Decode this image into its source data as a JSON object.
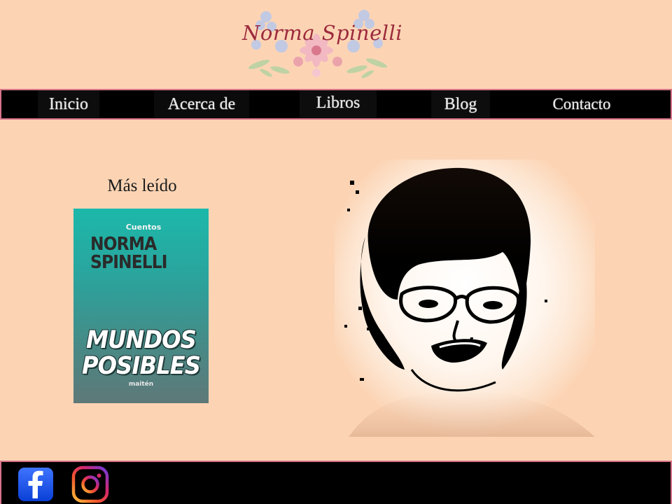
{
  "site": {
    "logo_text": "Norma Spinelli"
  },
  "nav": {
    "items": [
      {
        "label": "Inicio"
      },
      {
        "label": "Acerca de"
      },
      {
        "label": "Libros"
      },
      {
        "label": "Blog"
      },
      {
        "label": "Contacto"
      }
    ]
  },
  "main": {
    "section_title": "Más leído",
    "book": {
      "genre": "Cuentos",
      "author_line1": "NORMA",
      "author_line2": "SPINELLI",
      "title_line1": "MUNDOS",
      "title_line2": "POSIBLES",
      "publisher": "maitén"
    }
  },
  "footer": {
    "social": [
      {
        "name": "facebook-icon"
      },
      {
        "name": "instagram-icon"
      }
    ]
  },
  "colors": {
    "background": "#fcd4b4",
    "nav_bg": "#000000",
    "border_accent": "#d8748a",
    "logo_text": "#9c2b3d"
  }
}
